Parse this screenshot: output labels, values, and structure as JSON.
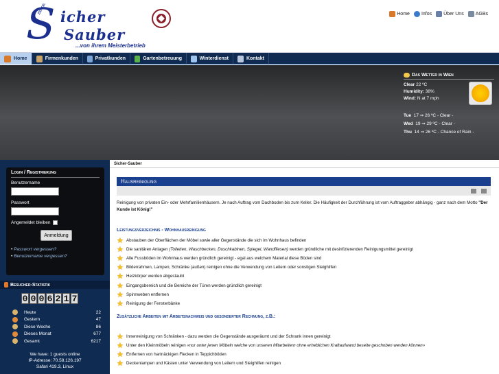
{
  "header": {
    "logo_small": "ZERTIF.",
    "logo_big": "S",
    "logo_word1": "icher",
    "logo_word2": "Sauber",
    "logo_tagline": "...von ihrem Meisterbetrieb",
    "seal_text_top": "MEISTER",
    "seal_text_bottom": "BETRIEB",
    "top_links": [
      {
        "label": "Home",
        "icon": "home-icon"
      },
      {
        "label": "Infos",
        "icon": "info-globe-icon"
      },
      {
        "label": "Über Uns",
        "icon": "about-icon"
      },
      {
        "label": "AGBs",
        "icon": "agb-icon"
      }
    ]
  },
  "nav": {
    "items": [
      {
        "label": "Home",
        "icon": "home-icon"
      },
      {
        "label": "Firmenkunden",
        "icon": "company-icon"
      },
      {
        "label": "Privatkunden",
        "icon": "private-icon"
      },
      {
        "label": "Gartenbetreuung",
        "icon": "garden-icon"
      },
      {
        "label": "Winterdienst",
        "icon": "winter-icon"
      },
      {
        "label": "Kontakt",
        "icon": "contact-icon"
      }
    ]
  },
  "weather": {
    "title": "Das Wetter in Wien",
    "now1": "Clear",
    "now1_val": "22 ºC",
    "now2": "Humidity:",
    "now2_val": "38%",
    "now3": "Wind:",
    "now3_val": "N at 7 mph",
    "forecast": [
      {
        "day": "Tue",
        "text": "17 ⇒ 26 ºC - Clear -"
      },
      {
        "day": "Wed",
        "text": "19 ⇒ 29 ºC - Clear -"
      },
      {
        "day": "Thu",
        "text": "14 ⇒ 26 ºC - Chance of Rain -"
      }
    ]
  },
  "login": {
    "title": "Login / Registrierung",
    "user_label": "Benutzername",
    "pass_label": "Passwort",
    "remember": "Angemeldet bleiben",
    "button": "Anmeldung",
    "forgot_pass": "Passwort vergessen?",
    "forgot_user": "Benutzername vergessen?"
  },
  "stats": {
    "title": "Besucher-Statistik",
    "counter": [
      "0",
      "0",
      "0",
      "6",
      "2",
      "1",
      "7"
    ],
    "rows": [
      {
        "label": "Heute",
        "value": "22"
      },
      {
        "label": "Gestern",
        "value": "47"
      },
      {
        "label": "Diese Woche",
        "value": "86"
      },
      {
        "label": "Dieses Monat",
        "value": "677"
      },
      {
        "label": "Gesamt",
        "value": "6217"
      }
    ],
    "online": "We have: 1 guests online",
    "ip": "IP-Adresse: 70.58.126.197",
    "browser": "Safari 419.3, Linux"
  },
  "main": {
    "breadcrumb": "Sicher-Sauber",
    "title": "Hausreinigung",
    "intro_pre": "Reinigung von privaten Ein- oder Mehrfamilienhäusern. Je nach Auftrag vom Dachboden bis zum Keller. Die Häufigkeit der Durchführung ist vom Auftraggeber abhängig - ganz nach dem Motto ",
    "intro_bold": "\"Der Kunde ist König!\"",
    "section1": "Leistungsverzeichnis - Wohnhausreinigung",
    "list1": [
      {
        "a": "Abstauben der Oberflächen der Möbel sowie aller Gegenstände die sich im Wohnhaus befinden",
        "i": "",
        "b": ""
      },
      {
        "a": "Die sanitären Anlagen ",
        "i": "(Toiletten, Waschbecken, Duschkabinen, Spiegel, Wandfliesen)",
        "b": " werden gründliche mit desinfizierenden Reinigungsmittel gereinigt"
      },
      {
        "a": "Alle Fussböden im Wohnhaus werden gründlich gereinigt - egal aus welchem Material diese Böden sind",
        "i": "",
        "b": ""
      },
      {
        "a": "Bilderrahmen, Lampen, Schränke (außen) reinigen ohne die Verwendung von Leitern oder sonstigen Steighilfen",
        "i": "",
        "b": ""
      },
      {
        "a": "Heizkörper werden abgestaubt",
        "i": "",
        "b": ""
      },
      {
        "a": "Eingangsbereich und die Bereiche der Türen werden gründlich gereinigt",
        "i": "",
        "b": ""
      },
      {
        "a": "Spinnweben entfernen",
        "i": "",
        "b": ""
      },
      {
        "a": "Reinigung der Fensterbänke",
        "i": "",
        "b": ""
      }
    ],
    "section2": "Zusätzliche Arbeiten mit Arbeitsnachweis und gesonderter Rechnung, z.B.:",
    "list2": [
      {
        "a": "Innenreinigung von Schränken - dazu werden die Gegenstände ausgeräumt und der Schrank innen gereinigt",
        "i": "",
        "b": ""
      },
      {
        "a": "Unter den Kleinmöbeln reinigen ",
        "i": "«nur unter jenen Möbeln welche von unseren Mitarbeitern ohne erheblichen Kraftaufwand beseite geschoben werden können»",
        "b": ""
      },
      {
        "a": "Entfernen von hartnäckigen Flecken in Teppichböden",
        "i": "",
        "b": ""
      },
      {
        "a": "Deckenlampen und Kästen unter Verwendung von Leitern und Steighilfen reinigen",
        "i": "",
        "b": ""
      }
    ]
  }
}
